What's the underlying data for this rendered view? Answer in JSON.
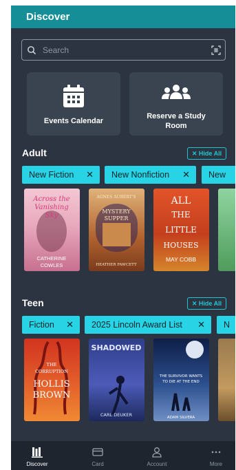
{
  "header": {
    "title": "Discover"
  },
  "search": {
    "placeholder": "Search"
  },
  "tiles": [
    {
      "label_line1": "Events Calendar",
      "label_line2": ""
    },
    {
      "label_line1": "Reserve a Study",
      "label_line2": "Room"
    }
  ],
  "sections": [
    {
      "title": "Adult",
      "hide_label": "✕ Hide All",
      "chips": [
        "New Fiction",
        "New Nonfiction",
        "New"
      ],
      "books": [
        {
          "title": "Across the Vanishing Sky",
          "author": "CATHERINE COWLES"
        },
        {
          "title": "Agnes Aubert's Mystery Supper",
          "author": "HEATHER FAWCETT"
        },
        {
          "title": "ALL THE LITTLE HOUSES",
          "author": "MAY COBB"
        }
      ]
    },
    {
      "title": "Teen",
      "hide_label": "✕ Hide All",
      "chips": [
        "Fiction",
        "2025 Lincoln Award List",
        "N"
      ],
      "books": [
        {
          "title": "THE CORRUPTION",
          "author": "HOLLIS BROWN"
        },
        {
          "title": "SHADOWED",
          "author": "CARL DEUKER"
        },
        {
          "title": "THE SURVIVOR WANTS TO DIE AT THE END",
          "author": "ADAM SILVERA"
        }
      ]
    }
  ],
  "bottom_nav": [
    {
      "label": "Discover",
      "icon": "discover-icon",
      "active": true
    },
    {
      "label": "Card",
      "icon": "card-icon",
      "active": false
    },
    {
      "label": "Account",
      "icon": "account-icon",
      "active": false
    },
    {
      "label": "More",
      "icon": "more-icon",
      "active": false
    }
  ],
  "colors": {
    "header": "#168e97",
    "background": "#2b3440",
    "chip": "#27d3e4",
    "accent": "#1fc7d4",
    "nav": "#1e252e"
  }
}
